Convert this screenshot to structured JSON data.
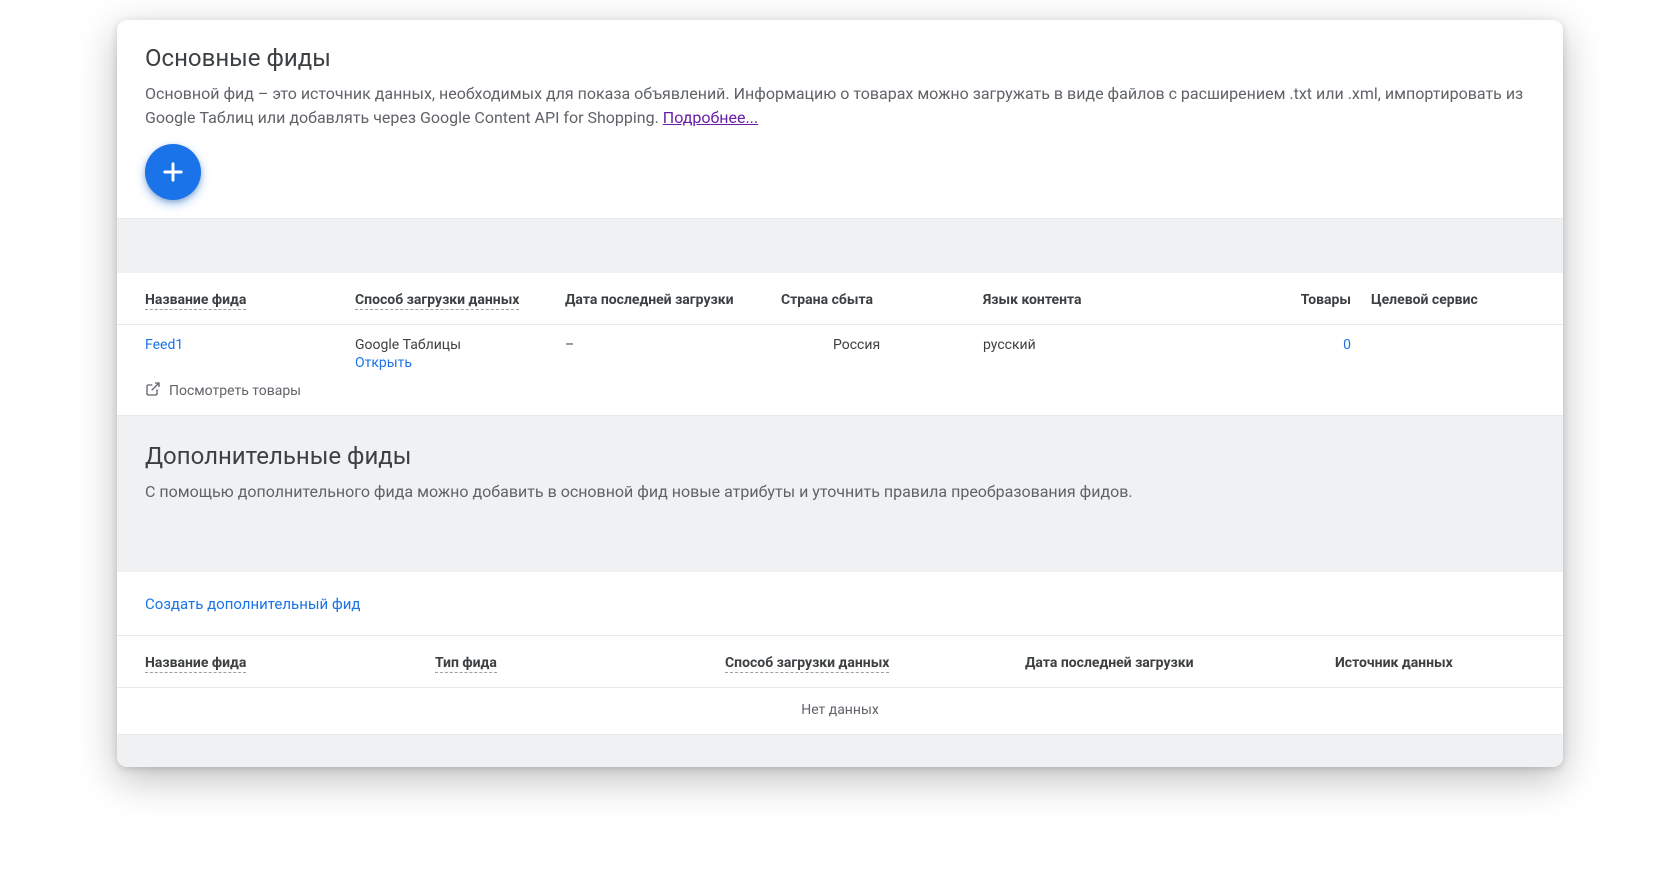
{
  "primary": {
    "title": "Основные фиды",
    "description": "Основной фид – это источник данных, необходимых для показа объявлений. Информацию о товарах можно загружать в виде файлов с расширением .txt или .xml, импортировать из Google Таблиц или добавлять через Google Content API for Shopping. ",
    "learn_more": "Подробнее...",
    "columns": {
      "name": "Название фида",
      "method": "Способ загрузки данных",
      "date": "Дата последней загрузки",
      "country": "Страна сбыта",
      "language": "Язык контента",
      "items": "Товары",
      "service": "Целевой сервис"
    },
    "rows": [
      {
        "name": "Feed1",
        "method": "Google Таблицы",
        "open": "Открыть",
        "date": "–",
        "country": "Россия",
        "language": "русский",
        "items": "0",
        "service": ""
      }
    ],
    "view_products": "Посмотреть товары"
  },
  "secondary": {
    "title": "Дополнительные фиды",
    "description": "С помощью дополнительного фида можно добавить в основной фид новые атрибуты и уточнить правила преобразования фидов.",
    "create_link": "Создать дополнительный фид",
    "columns": {
      "name": "Название фида",
      "type": "Тип фида",
      "method": "Способ загрузки данных",
      "date": "Дата последней загрузки",
      "source": "Источник данных"
    },
    "no_data": "Нет данных"
  }
}
